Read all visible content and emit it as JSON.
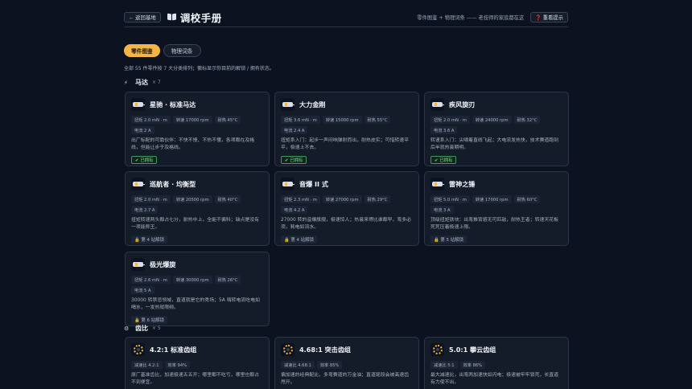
{
  "header": {
    "back_label": "← 返回基地",
    "title": "调校手册",
    "tagline": "零件图鉴 + 物理词条 —— 老技师的家底都在这",
    "help_label": "❓ 重看提示"
  },
  "tabs": [
    {
      "label": "零件图鉴",
      "active": true
    },
    {
      "label": "物理词条",
      "active": false
    }
  ],
  "summary": "全部 55 件零件按 7 大分类排列；徽标显示你目前的解锁 / 拥有状态。",
  "sections": {
    "motors": {
      "icon": "motor-icon",
      "glyph": "⚡",
      "title": "马达",
      "count": "× 7"
    },
    "gears": {
      "icon": "gear-icon",
      "glyph": "⚙",
      "title": "齿比",
      "count": "× 5"
    }
  },
  "motors": [
    {
      "name": "星驰 · 标准马达",
      "specs": [
        "扭矩 2.0 mN · m",
        "转速 17000 rpm",
        "耐热 45°C",
        "电流 2 A"
      ],
      "desc": "出厂标配的可靠伙伴：不快不慢、不热不懂，各项都在及格线，但能让步于及格线。",
      "status": "owned",
      "status_label": "✔ 已拥有"
    },
    {
      "name": "大力金刚",
      "specs": [
        "扭矩 3.6 mN · m",
        "转速 15000 rpm",
        "耐热 55°C",
        "电流 2.4 A"
      ],
      "desc": "扭矩系入门：起步一声闷响弹射而出，耐热皮实；可惜转速平平，极速上不去。",
      "status": "owned",
      "status_label": "✔ 已拥有"
    },
    {
      "name": "疾风旋刃",
      "specs": [
        "扭矩 2.0 mN · m",
        "转速 24000 rpm",
        "耐热 32°C",
        "电流 3.6 A"
      ],
      "desc": "转速系入门：尖啸着直线飞起；大电流发热快，技术赛道跑到后半就热衰期明。",
      "status": "owned",
      "status_label": "✔ 已拥有"
    },
    {
      "name": "巡航者 · 均衡型",
      "specs": [
        "扭矩 2.0 mN · m",
        "转速 20500 rpm",
        "耐热 40°C",
        "电流 2.7 A"
      ],
      "desc": "扭矩转速两头都占七分，耐热中上，全能不偏科；缺点是没有一项能称王。",
      "status": "locked",
      "status_label": "🔒 第 4 站解锁"
    },
    {
      "name": "音爆 II 式",
      "specs": [
        "扭矩 2.3 mN · m",
        "转速 27000 rpm",
        "耐热 29°C",
        "电流 4.2 A"
      ],
      "desc": "27000 转的音爆旗舰，极速惊人；热衰来得比谁都早，弯多必须，耗电如流水。",
      "status": "locked",
      "status_label": "🔒 第 4 站解锁"
    },
    {
      "name": "雷神之锤",
      "specs": [
        "扭矩 5.0 mN · m",
        "转速 17000 rpm",
        "耐热 60°C",
        "电流 3 A"
      ],
      "desc": "顶级扭矩铁块：出弯推背感无可匹敌，耐热王者；转速天花板死死压着极速上限。",
      "status": "locked",
      "status_label": "🔒 第 5 站解锁"
    },
    {
      "name": "极光爆旋",
      "specs": [
        "扭矩 2.6 mN · m",
        "转速 30000 rpm",
        "耐热 26°C",
        "电流 5 A"
      ],
      "desc": "30000 转禁忌领域，直道就是它的秀场；5A 嗨转电流吃电如喝水，一发热就限频。",
      "status": "locked",
      "status_label": "🔒 第 6 站解锁"
    }
  ],
  "gears": [
    {
      "name": "4.2:1 标准齿组",
      "specs": [
        "减速比 4.2:1",
        "效率 94%"
      ],
      "desc": "原厂基准齿比，加速极速五五开；哪里都不吃亏，哪里也都占不到便宜。"
    },
    {
      "name": "4.68:1 突击齿组",
      "specs": [
        "减速比 4.68:1",
        "效率 85%"
      ],
      "desc": "偏加速的经典配比，多弯赛道的万金油；直道尾段会被高速齿甩开。"
    },
    {
      "name": "5.0:1 攀云齿组",
      "specs": [
        "减速比 5:1",
        "效率 86%"
      ],
      "desc": "最大减速比，出弯两加速快如闪电；极速被牢牢锁死，长直道有力使不出。"
    }
  ],
  "colors": {
    "accent": "#f2b546",
    "background": "#0c1220",
    "card": "#141b29",
    "owned": "#7fd99a"
  }
}
